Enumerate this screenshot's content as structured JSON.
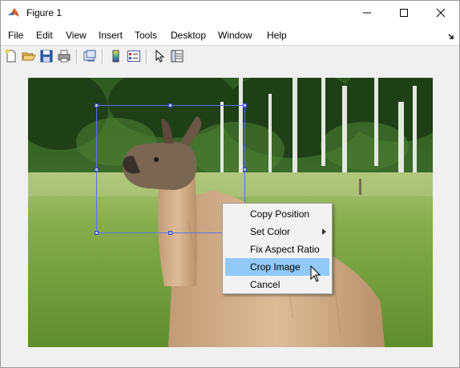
{
  "window": {
    "title": "Figure 1",
    "app_icon": "matlab-icon",
    "controls": [
      "minimize-icon",
      "maximize-icon",
      "close-icon"
    ]
  },
  "menubar": {
    "items": [
      "File",
      "Edit",
      "View",
      "Insert",
      "Tools",
      "Desktop",
      "Window",
      "Help"
    ],
    "dock_icon": "dock-arrow-icon"
  },
  "toolbar": {
    "buttons": [
      "new-figure-icon",
      "open-file-icon",
      "save-icon",
      "print-icon",
      "link-plot-icon",
      "insert-colorbar-icon",
      "insert-legend-icon",
      "pointer-icon",
      "property-inspector-icon"
    ]
  },
  "figure": {
    "image": "photo of an alpaca standing in a grassy field with trees behind",
    "roi": {
      "edge_color": "#5a6ef0",
      "handle_color": "#b9c4ff"
    }
  },
  "context_menu": {
    "items": [
      {
        "label": "Copy Position",
        "has_submenu": false,
        "active": false
      },
      {
        "label": "Set Color",
        "has_submenu": true,
        "active": false
      },
      {
        "label": "Fix Aspect Ratio",
        "has_submenu": false,
        "active": false
      },
      {
        "label": "Crop Image",
        "has_submenu": false,
        "active": true
      },
      {
        "label": "Cancel",
        "has_submenu": false,
        "active": false
      }
    ],
    "highlight_color": "#91c9f7"
  }
}
